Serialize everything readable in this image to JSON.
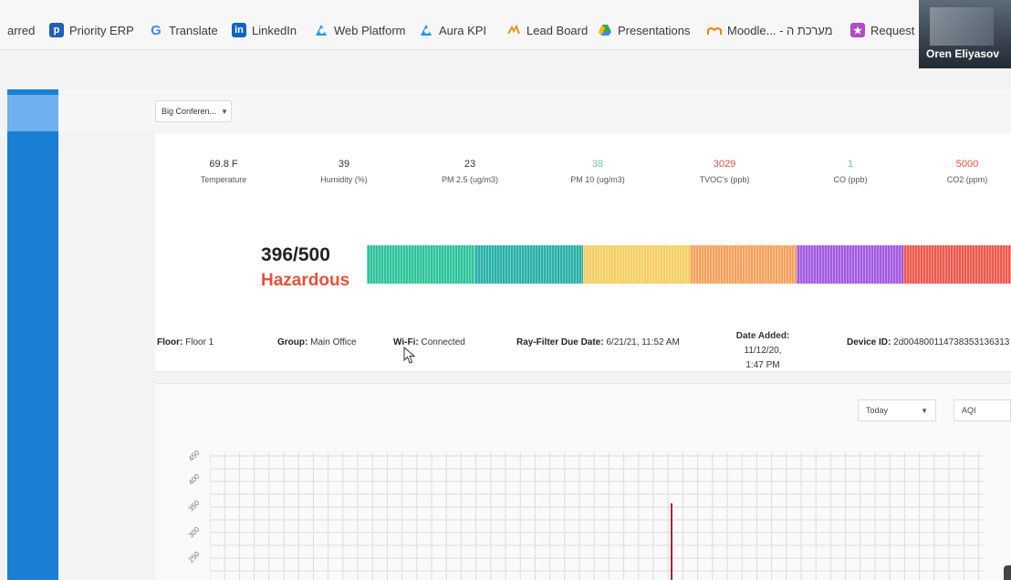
{
  "bookmarks": [
    {
      "label": "arred",
      "icon": "",
      "icon_text": "",
      "icon_color": ""
    },
    {
      "label": "Priority ERP",
      "icon": "priority-erp-icon",
      "icon_text": "p",
      "icon_color": "#1f5fb4"
    },
    {
      "label": "Translate",
      "icon": "google-translate-icon",
      "icon_text": "G",
      "icon_color": "#4285f4"
    },
    {
      "label": "LinkedIn",
      "icon": "linkedin-icon",
      "icon_text": "in",
      "icon_color": "#0a66c2"
    },
    {
      "label": "Web Platform",
      "icon": "web-platform-icon",
      "icon_text": "",
      "icon_color": "#2196f3"
    },
    {
      "label": "Aura KPI",
      "icon": "aura-kpi-icon",
      "icon_text": "",
      "icon_color": "#2196f3"
    },
    {
      "label": "Lead Board",
      "icon": "lead-board-icon",
      "icon_text": "",
      "icon_color": "#e0a030"
    },
    {
      "label": "Presentations",
      "icon": "google-drive-icon",
      "icon_text": "",
      "icon_color": "#34a853"
    },
    {
      "label": "Moodle... - מערכת ה",
      "icon": "moodle-icon",
      "icon_text": "",
      "icon_color": "#f98012"
    },
    {
      "label": "Request",
      "icon": "request-icon",
      "icon_text": "",
      "icon_color": "#b04cc8"
    }
  ],
  "video": {
    "name": "Oren Eliyasov"
  },
  "room_selector": {
    "value": "Big Conferen..."
  },
  "metrics": [
    {
      "value": "69.8 F",
      "label": "Temperature",
      "color": "#333333"
    },
    {
      "value": "39",
      "label": "Humidity (%)",
      "color": "#333333"
    },
    {
      "value": "23",
      "label": "PM 2.5 (ug/m3)",
      "color": "#333333"
    },
    {
      "value": "38",
      "label": "PM 10 (ug/m3)",
      "color": "#6fc7a0"
    },
    {
      "value": "3029",
      "label": "TVOC's (ppb)",
      "color": "#e8503f"
    },
    {
      "value": "1",
      "label": "CO (ppb)",
      "color": "#6fc7a0"
    },
    {
      "value": "5000",
      "label": "CO2 (ppm)",
      "color": "#e8503f"
    }
  ],
  "aqi": {
    "score": "396/500",
    "status": "Hazardous",
    "status_color": "#e8503f",
    "segments": [
      {
        "color": "#2ec39b"
      },
      {
        "color": "#29b0a8"
      },
      {
        "color": "#f6cf62"
      },
      {
        "color": "#f4a25e"
      },
      {
        "color": "#a25be0"
      },
      {
        "color": "#ec5a4e"
      }
    ]
  },
  "info": {
    "floor": {
      "label": "Floor:",
      "value": "Floor 1"
    },
    "group": {
      "label": "Group:",
      "value": "Main Office"
    },
    "wifi": {
      "label": "Wi-Fi:",
      "value": "Connected"
    },
    "filter": {
      "label": "Ray-Filter Due Date:",
      "value": "6/21/21, 11:52 AM"
    },
    "added": {
      "label": "Date Added:",
      "value": "11/12/20,",
      "value2": "1:47 PM"
    },
    "device": {
      "label": "Device ID:",
      "value": "2d004800114738353136313"
    }
  },
  "chart_controls": {
    "range": "Today",
    "metric": "AQI"
  },
  "chart_data": {
    "type": "bar",
    "title": "",
    "xlabel": "",
    "ylabel": "",
    "yticks": [
      "450",
      "400",
      "350",
      "300",
      "250"
    ],
    "ylim": [
      200,
      450
    ],
    "grid": true,
    "series": [
      {
        "values": [
          350
        ]
      }
    ],
    "bar_color": "#a8282f"
  }
}
